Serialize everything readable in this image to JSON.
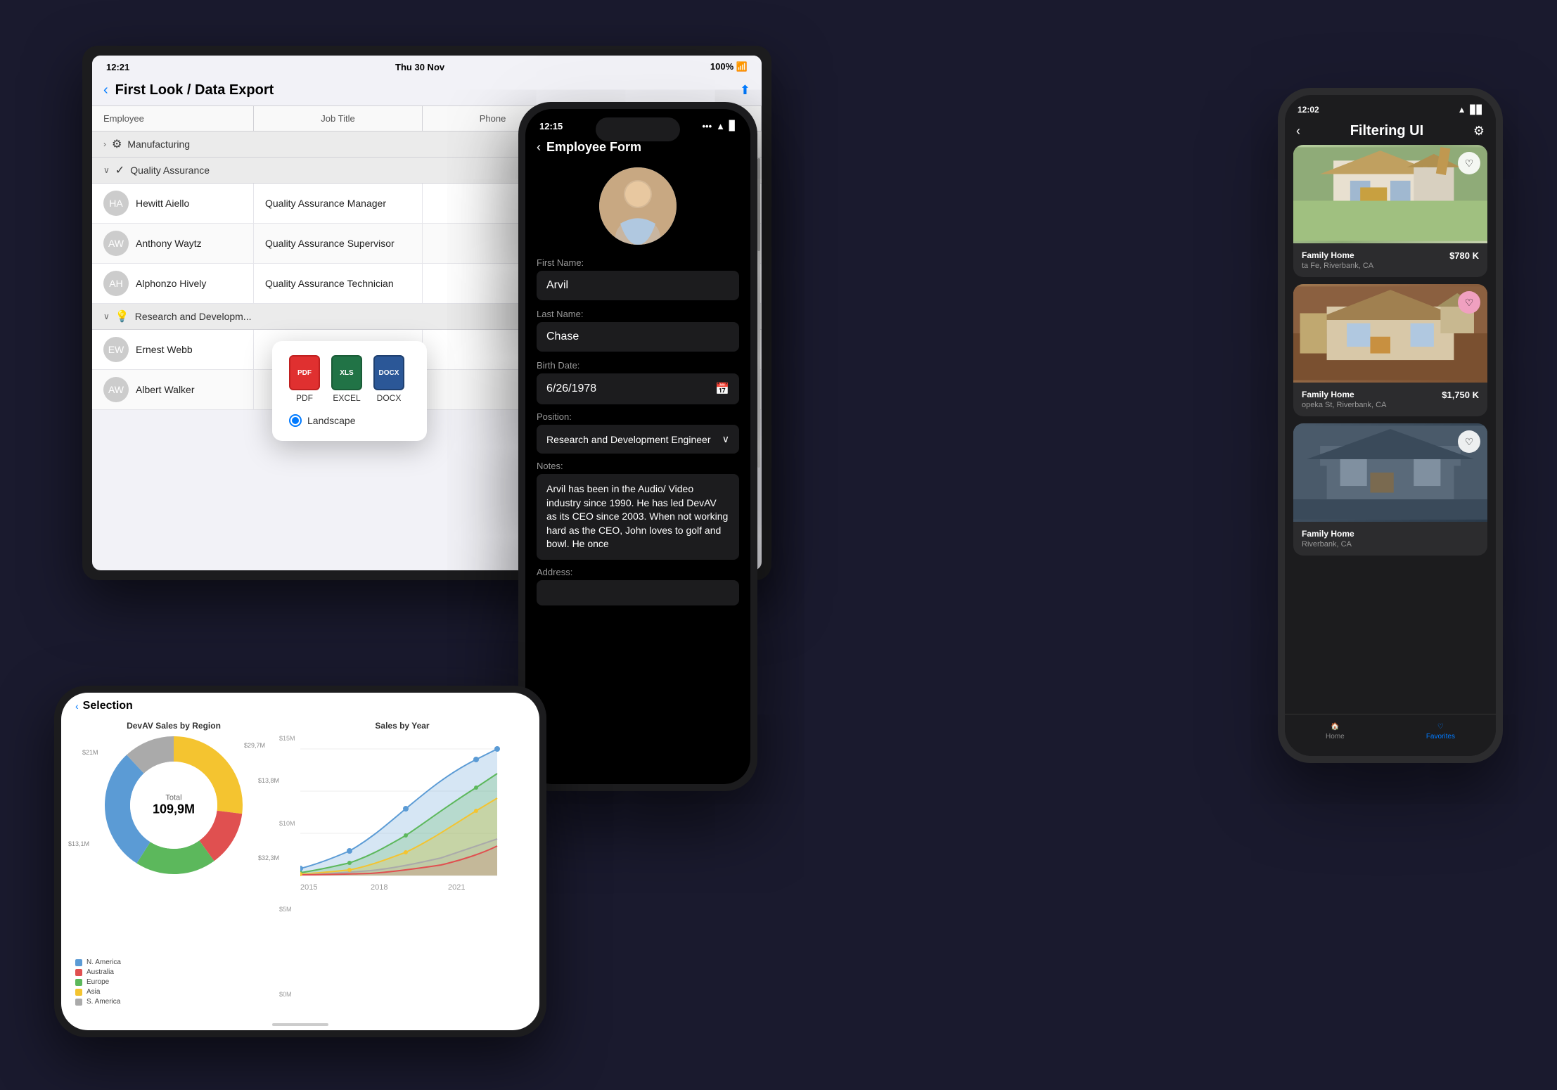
{
  "ipad": {
    "status": {
      "time": "12:21",
      "date": "Thu 30 Nov",
      "battery": "100%"
    },
    "title": "First Look / Data Export",
    "columns": [
      "Employee",
      "Job Title",
      "Phone"
    ],
    "groups": [
      {
        "name": "Manufacturing",
        "icon": "⚙️",
        "expanded": false,
        "rows": []
      },
      {
        "name": "Quality Assurance",
        "icon": "✅",
        "expanded": true,
        "rows": [
          {
            "name": "Hewitt Aiello",
            "title": "Quality Assurance Manager",
            "phone": ""
          },
          {
            "name": "Anthony Waytz",
            "title": "Quality Assurance Supervisor",
            "phone": ""
          },
          {
            "name": "Alphonzo Hively",
            "title": "Quality Assurance Technician",
            "phone": ""
          }
        ]
      },
      {
        "name": "Research and Developm...",
        "icon": "💡",
        "expanded": true,
        "rows": [
          {
            "name": "Ernest Webb",
            "title": "",
            "phone": ""
          },
          {
            "name": "Albert Walker",
            "title": "",
            "phone": ""
          }
        ]
      }
    ],
    "export_popup": {
      "formats": [
        "PDF",
        "EXCEL",
        "DOCX"
      ],
      "orientation": "Landscape"
    }
  },
  "iphone_center": {
    "status": {
      "time": "12:15",
      "dots": "•••",
      "wifi": "WiFi",
      "battery": "Battery"
    },
    "title": "Employee Form",
    "fields": {
      "first_name_label": "First Name:",
      "first_name_value": "Arvil",
      "last_name_label": "Last Name:",
      "last_name_value": "Chase",
      "birth_date_label": "Birth Date:",
      "birth_date_value": "6/26/1978",
      "position_label": "Position:",
      "position_value": "Research and Development Engineer",
      "notes_label": "Notes:",
      "notes_value": "Arvil has been in the Audio/ Video industry since 1990. He has led DevAV as its CEO since 2003. When not working hard as the CEO, John loves to golf and bowl. He once",
      "address_label": "Address:"
    }
  },
  "iphone_right": {
    "status": {
      "time": "12:02"
    },
    "title": "Filtering UI",
    "properties": [
      {
        "type": "Family Home",
        "address": "ta Fe, Riverbank, CA",
        "price": "$780 K",
        "heart": "outline"
      },
      {
        "type": "Family Home",
        "address": "opeka St, Riverbank, CA",
        "price": "$1,750 K",
        "heart": "pink"
      },
      {
        "type": "Family Home",
        "address": "Riverbank, CA",
        "price": "",
        "heart": "outline"
      }
    ],
    "nav": [
      "Home",
      "Favorites"
    ]
  },
  "iphone_chart": {
    "status": "Selection",
    "donut": {
      "title": "DevAV Sales by Region",
      "total_label": "Total",
      "total_value": "109,9M",
      "segments": [
        {
          "label": "Asia",
          "value": "$29,7M",
          "color": "#f4c430",
          "pct": 27
        },
        {
          "label": "Australia",
          "value": "$13,8M",
          "color": "#e05050",
          "pct": 13
        },
        {
          "label": "Europe",
          "value": "$21M",
          "color": "#5cb85c",
          "pct": 19
        },
        {
          "label": "N. America",
          "value": "$32,3M",
          "color": "#5b9bd5",
          "pct": 29
        },
        {
          "label": "S. America",
          "value": "$13,1M",
          "color": "#aaaaaa",
          "pct": 12
        }
      ]
    },
    "line": {
      "title": "Sales by Year",
      "years": [
        "2015",
        "2018",
        "2021"
      ],
      "y_labels": [
        "$0M",
        "$5M",
        "$10M",
        "$15M"
      ]
    }
  }
}
